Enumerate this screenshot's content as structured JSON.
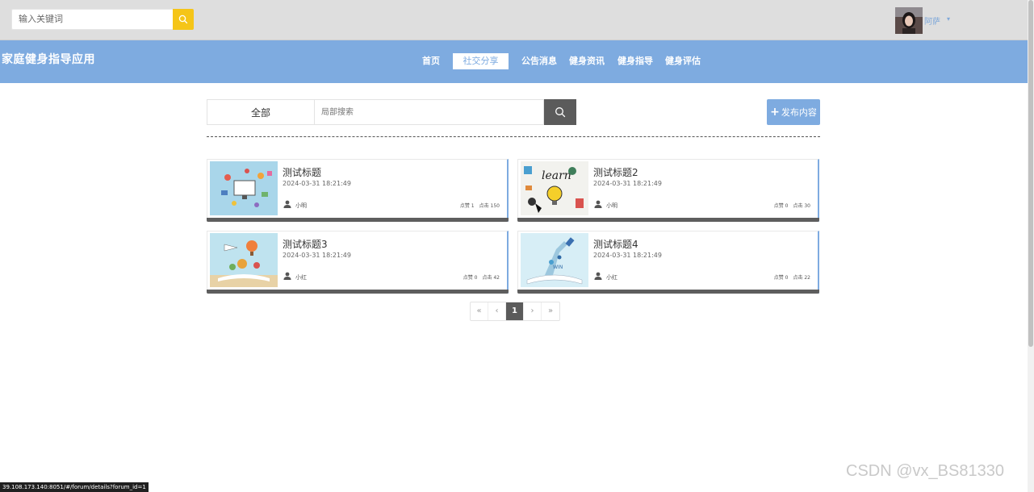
{
  "header": {
    "search_placeholder": "输入关键词",
    "username": "阿萨",
    "brand": "家庭健身指导应用"
  },
  "nav": {
    "items": [
      {
        "label": "首页"
      },
      {
        "label": "社交分享"
      },
      {
        "label": "公告消息"
      },
      {
        "label": "健身资讯"
      },
      {
        "label": "健身指导"
      },
      {
        "label": "健身评估"
      }
    ],
    "active_index": 1
  },
  "filter": {
    "category": "全部",
    "search_placeholder": "局部搜索",
    "publish_label": "发布内容"
  },
  "posts": [
    {
      "title": "测试标题",
      "date": "2024-03-31 18:21:49",
      "author": "小明",
      "likes": "点赞 1",
      "clicks": "点击 150"
    },
    {
      "title": "测试标题2",
      "date": "2024-03-31 18:21:49",
      "author": "小明",
      "likes": "点赞 0",
      "clicks": "点击 30"
    },
    {
      "title": "测试标题3",
      "date": "2024-03-31 18:21:49",
      "author": "小红",
      "likes": "点赞 0",
      "clicks": "点击 42"
    },
    {
      "title": "测试标题4",
      "date": "2024-03-31 18:21:49",
      "author": "小红",
      "likes": "点赞 0",
      "clicks": "点击 22"
    }
  ],
  "pagination": {
    "first": "«",
    "prev": "‹",
    "current": "1",
    "next": "›",
    "last": "»"
  },
  "status_url": "39.108.173.140:8051/#/forum/details?forum_id=1",
  "watermark": "CSDN @vx_BS81330",
  "colors": {
    "accent": "#7eabe0",
    "search_button": "#f5c518",
    "dark_button": "#5b5b5b"
  }
}
